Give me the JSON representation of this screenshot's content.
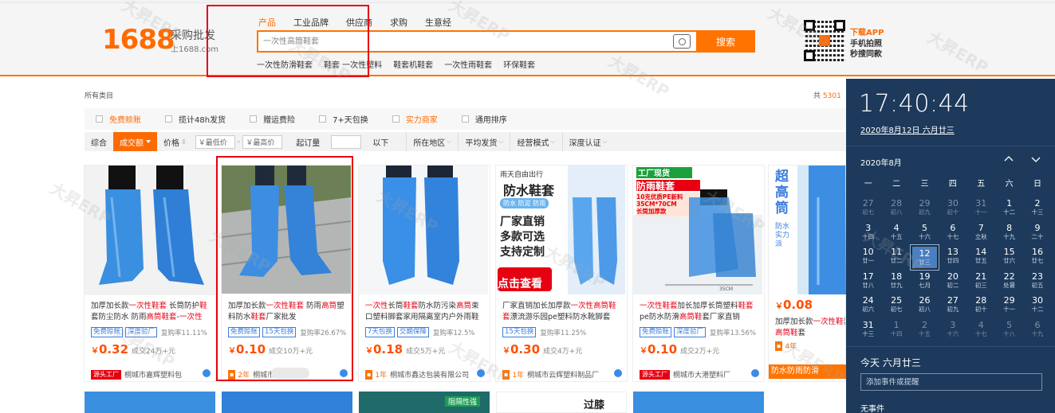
{
  "header": {
    "logo": "1688",
    "logo_cn": "采购批发",
    "logo_url": "上1688.com",
    "search_tabs": [
      "产品",
      "工业品牌",
      "供应商",
      "求购",
      "生意经"
    ],
    "search_placeholder": "一次性高筒鞋套",
    "search_button": "搜索",
    "hot_words": [
      "一次性防滑鞋套",
      "鞋套 一次性塑料",
      "鞋套机鞋套",
      "一次性雨鞋套",
      "环保鞋套"
    ],
    "app": {
      "title": "下载APP",
      "line1": "手机拍照",
      "line2": "秒搜同款"
    }
  },
  "filters": {
    "breadcrumb": "所有类目",
    "total_prefix": "共",
    "total_count": "5301",
    "row1": [
      {
        "label": "免费赊账",
        "highlight": true
      },
      {
        "label": "揽计48h发货",
        "highlight": false
      },
      {
        "label": "赠运费险",
        "highlight": false
      },
      {
        "label": "7+天包换",
        "highlight": false
      },
      {
        "label": "实力商家",
        "highlight": true
      },
      {
        "label": "通用排序",
        "highlight": false
      }
    ],
    "sort": {
      "general": "综合",
      "volume": "成交额",
      "price": "价格"
    },
    "price_min_placeholder": "￥最低价",
    "price_sep": "-",
    "price_max_placeholder": "￥最高价",
    "qty_label": "起订量",
    "qty_suffix": "以下",
    "dropdowns": [
      "所在地区",
      "平均发货",
      "经营模式",
      "深度认证"
    ]
  },
  "products": [
    {
      "title_parts": [
        [
          "加厚加长款",
          false
        ],
        [
          "一次性鞋套",
          true
        ],
        [
          " 长筒防护",
          false
        ],
        [
          "鞋",
          true
        ],
        [
          "套",
          false
        ],
        [
          "防尘防水 防雨",
          false
        ],
        [
          "高筒鞋套",
          true
        ],
        [
          "-",
          false
        ],
        [
          "一次性",
          true
        ]
      ],
      "tags": [
        "免费赊账",
        "深度验厂"
      ],
      "rate": "复购率11.11%",
      "price": "0.32",
      "sales": "成交24万+元",
      "badge": "源头工厂",
      "badge_type": "src",
      "seller": "桐城市嘉辉塑料包"
    },
    {
      "title_parts": [
        [
          "加厚加长款",
          false
        ],
        [
          "一次性鞋套",
          true
        ],
        [
          " 防雨",
          false
        ],
        [
          "高筒",
          true
        ],
        [
          "塑料",
          false
        ],
        [
          "防水",
          false
        ],
        [
          "鞋套",
          true
        ],
        [
          "厂家批发",
          false
        ]
      ],
      "tags": [
        "免费赊账",
        "15天包换"
      ],
      "rate": "复购率26.67%",
      "price": "0.10",
      "sales": "成交10万+元",
      "badge": "2年",
      "badge_type": "yr",
      "seller": "桐城市"
    },
    {
      "title_parts": [
        [
          "一次性",
          true
        ],
        [
          "长筒",
          false
        ],
        [
          "鞋套",
          true
        ],
        [
          "防水防污染",
          false
        ],
        [
          "高筒",
          true
        ],
        [
          "束口塑料脚套家用隔离室内户外雨鞋",
          false
        ]
      ],
      "tags": [
        "7天包换",
        "交期保障"
      ],
      "rate": "复购率12.5%",
      "price": "0.18",
      "sales": "成交5万+元",
      "badge": "1年",
      "badge_type": "yr",
      "seller": "桐城市鑫达包装有限公司"
    },
    {
      "title_parts": [
        [
          "厂家直销加长加厚款",
          false
        ],
        [
          "一次性高筒鞋套",
          true
        ],
        [
          "漂流游乐园pe塑料防水靴脚套",
          false
        ]
      ],
      "tags": [
        "15天包换"
      ],
      "rate": "复购率11.25%",
      "price": "0.30",
      "sales": "成交4万+元",
      "badge": "1年",
      "badge_type": "yr",
      "seller": "桐城市云辉塑料制品厂"
    },
    {
      "title_parts": [
        [
          "一次性鞋套",
          true
        ],
        [
          "加长加厚长筒塑料",
          false
        ],
        [
          "鞋套",
          true
        ],
        [
          "pe防水防滑",
          false
        ],
        [
          "高筒鞋",
          true
        ],
        [
          "套厂家直销",
          false
        ]
      ],
      "tags": [
        "免费赊账",
        "深度验厂"
      ],
      "rate": "复购率13.56%",
      "price": "0.10",
      "sales": "成交2万+元",
      "badge": "源头工厂",
      "badge_type": "src",
      "seller": "桐城市大港塑料厂"
    },
    {
      "title_parts": [
        [
          "加厚加长款",
          false
        ],
        [
          "一次性鞋",
          true
        ],
        [
          "套防尘防水 防",
          false
        ],
        [
          "高筒鞋",
          true
        ],
        [
          "套",
          false
        ]
      ],
      "tags": [],
      "rate": "",
      "price": "0.08",
      "sales": "",
      "badge": "4年",
      "badge_type": "yr",
      "seller": ""
    }
  ],
  "image_texts": {
    "p3_top": "雨天自由出行",
    "p3_main": "防水鞋套",
    "p3_sub": "防水 防泥 防雨",
    "p3_l1": "厂家直销",
    "p3_l2": "多款可选",
    "p3_l3": "支持定制",
    "p3_btn": "点击查看",
    "p4_top": "工厂现货",
    "p4_main": "防雨鞋套",
    "p4_l1": "10克优质PE新料",
    "p4_l2": "35CM*70CM",
    "p4_l3": "长筒加厚款",
    "p4_ruler": "35CM",
    "p5_a": "超",
    "p5_b": "高",
    "p5_c": "筒",
    "p5_d": "防水实力派",
    "p5_banner": "防水防雨防滑",
    "b3_badge": "阻隔性强",
    "b4_text": "过膝"
  },
  "clock": {
    "time": "17:40:44",
    "date": "2020年8月12日 六月廿三",
    "month": "2020年8月",
    "weekdays": [
      "一",
      "二",
      "三",
      "四",
      "五",
      "六",
      "日"
    ],
    "weeks": [
      [
        [
          "27",
          "初七",
          1
        ],
        [
          "28",
          "初八",
          1
        ],
        [
          "29",
          "初九",
          1
        ],
        [
          "30",
          "初十",
          1
        ],
        [
          "31",
          "十一",
          1
        ],
        [
          "1",
          "十二",
          0
        ],
        [
          "2",
          "十三",
          0
        ]
      ],
      [
        [
          "3",
          "十四",
          0
        ],
        [
          "4",
          "十五",
          0
        ],
        [
          "5",
          "十六",
          0
        ],
        [
          "6",
          "十七",
          0
        ],
        [
          "7",
          "立秋",
          0
        ],
        [
          "8",
          "十九",
          0
        ],
        [
          "9",
          "二十",
          0
        ]
      ],
      [
        [
          "10",
          "廿一",
          0
        ],
        [
          "11",
          "廿二",
          0
        ],
        [
          "12",
          "廿三",
          2
        ],
        [
          "13",
          "廿四",
          0
        ],
        [
          "14",
          "廿五",
          0
        ],
        [
          "15",
          "廿六",
          0
        ],
        [
          "16",
          "廿七",
          0
        ]
      ],
      [
        [
          "17",
          "廿八",
          0
        ],
        [
          "18",
          "廿九",
          0
        ],
        [
          "19",
          "七月",
          0
        ],
        [
          "20",
          "初二",
          0
        ],
        [
          "21",
          "初三",
          0
        ],
        [
          "22",
          "处暑",
          0
        ],
        [
          "23",
          "初五",
          0
        ]
      ],
      [
        [
          "24",
          "初六",
          0
        ],
        [
          "25",
          "初七",
          0
        ],
        [
          "26",
          "初八",
          0
        ],
        [
          "27",
          "初九",
          0
        ],
        [
          "28",
          "初十",
          0
        ],
        [
          "29",
          "十一",
          0
        ],
        [
          "30",
          "十二",
          0
        ]
      ],
      [
        [
          "31",
          "十三",
          0
        ],
        [
          "1",
          "十四",
          1
        ],
        [
          "2",
          "十五",
          1
        ],
        [
          "3",
          "十六",
          1
        ],
        [
          "4",
          "十七",
          1
        ],
        [
          "5",
          "十八",
          1
        ],
        [
          "6",
          "十九",
          1
        ]
      ]
    ],
    "today_label": "今天 六月廿三",
    "event_placeholder": "添加事件或提醒",
    "no_event": "无事件"
  },
  "watermark": "大昇ERP",
  "colors": {
    "brand": "#ff6a00",
    "highlight": "#e60012",
    "tag": "#3b7ddd",
    "flyout": "#1d3a5c"
  }
}
